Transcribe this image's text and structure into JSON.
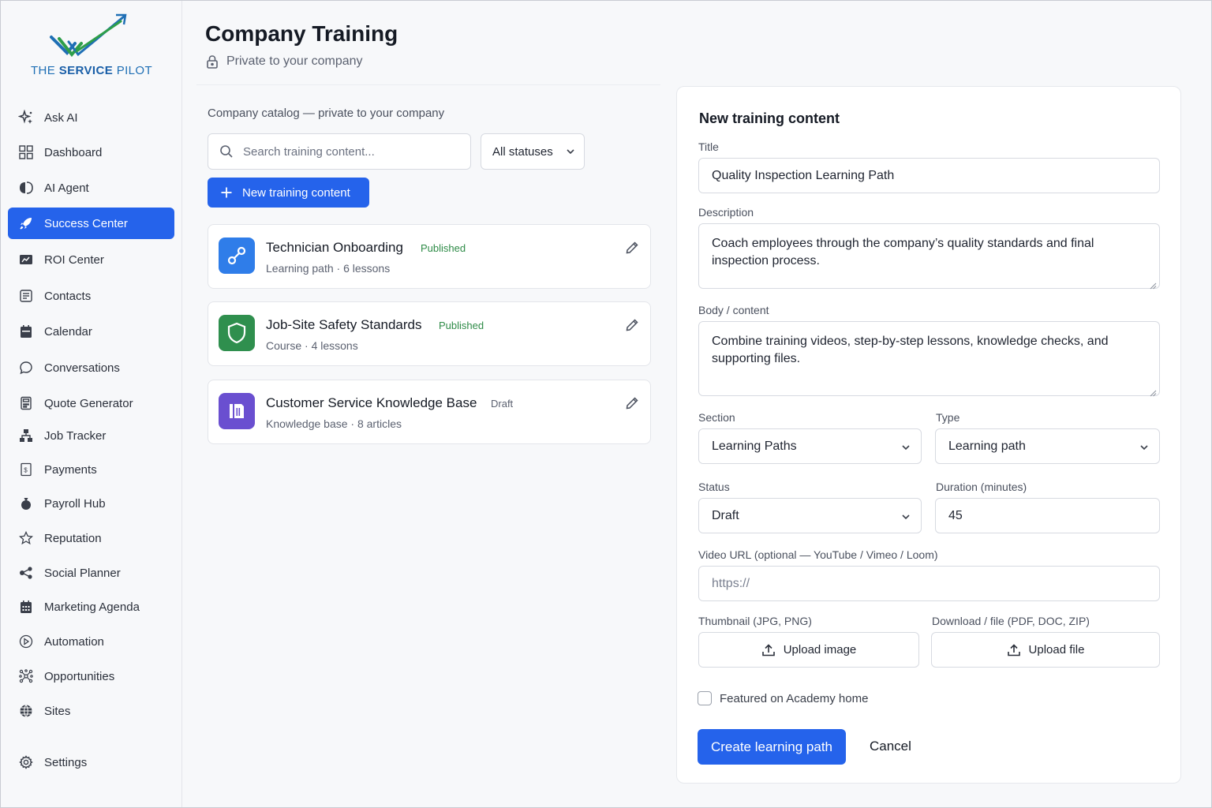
{
  "brand": {
    "logo_prefix": "THE ",
    "logo_bold": "SERVICE",
    "logo_suffix": " PILOT",
    "colors": {
      "blue": "#1f6fb5",
      "green": "#2e9e4a",
      "accent": "#2563eb"
    }
  },
  "sidebar": {
    "items": [
      {
        "label": "Ask AI",
        "icon": "sparkle-icon"
      },
      {
        "label": "Dashboard",
        "icon": "grid-icon"
      },
      {
        "label": "AI Agent",
        "icon": "brain-icon"
      },
      {
        "label": "Success Center",
        "icon": "rocket-icon",
        "active": true
      },
      {
        "label": "ROI Center",
        "icon": "chart-icon"
      },
      {
        "label": "Contacts",
        "icon": "contacts-icon"
      },
      {
        "label": "Calendar",
        "icon": "calendar-icon"
      },
      {
        "label": "Conversations",
        "icon": "chat-icon"
      },
      {
        "label": "Quote Generator",
        "icon": "calculator-icon"
      },
      {
        "label": "Job Tracker",
        "icon": "network-icon"
      },
      {
        "label": "Payments",
        "icon": "receipt-icon"
      },
      {
        "label": "Payroll Hub",
        "icon": "moneybag-icon"
      },
      {
        "label": "Reputation",
        "icon": "star-icon"
      },
      {
        "label": "Social Planner",
        "icon": "share-icon"
      },
      {
        "label": "Marketing Agenda",
        "icon": "calendar-grid-icon"
      },
      {
        "label": "Automation",
        "icon": "automation-icon"
      },
      {
        "label": "Opportunities",
        "icon": "opportunities-icon"
      },
      {
        "label": "Sites",
        "icon": "globe-icon"
      }
    ],
    "settings_label": "Settings"
  },
  "header": {
    "title": "Company Training",
    "subtitle": "Private to your company"
  },
  "catalog": {
    "label": "Company catalog — private to your company",
    "search_placeholder": "Search training content...",
    "status_filter": "All statuses",
    "new_button": "New training content",
    "items": [
      {
        "title": "Technician Onboarding",
        "status": "Published",
        "meta": "Learning path · 6 lessons",
        "thumb_color": "#2f7de9",
        "icon": "path-icon"
      },
      {
        "title": "Job-Site Safety Standards",
        "status": "Published",
        "meta": "Course · 4 lessons",
        "thumb_color": "#2f8f4e",
        "icon": "shield-icon"
      },
      {
        "title": "Customer Service Knowledge Base",
        "status": "Draft",
        "meta": "Knowledge base · 8 articles",
        "thumb_color": "#6a4fd0",
        "icon": "book-icon"
      }
    ],
    "status_colors": {
      "Published": "#2e8b47",
      "Draft": "#5b6170"
    }
  },
  "form": {
    "title": "New training content",
    "title_label": "Title",
    "title_value": "Quality Inspection Learning Path",
    "description_label": "Description",
    "description_value": "Coach employees through the company’s quality standards and final inspection process.",
    "body_label": "Body / content",
    "body_value": "Combine training videos, step-by-step lessons, knowledge checks, and supporting files.",
    "section_label": "Section",
    "section_value": "Learning Paths",
    "type_label": "Type",
    "type_value": "Learning path",
    "status_label": "Status",
    "status_value": "Draft",
    "duration_label": "Duration (minutes)",
    "duration_value": "45",
    "video_label": "Video URL (optional — YouTube / Vimeo / Loom)",
    "video_placeholder": "https://",
    "thumbnail_label": "Thumbnail (JPG, PNG)",
    "thumbnail_button": "Upload image",
    "file_label": "Download / file (PDF, DOC, ZIP)",
    "file_button": "Upload file",
    "featured_label": "Featured on Academy home",
    "submit_label": "Create learning path",
    "cancel_label": "Cancel"
  }
}
